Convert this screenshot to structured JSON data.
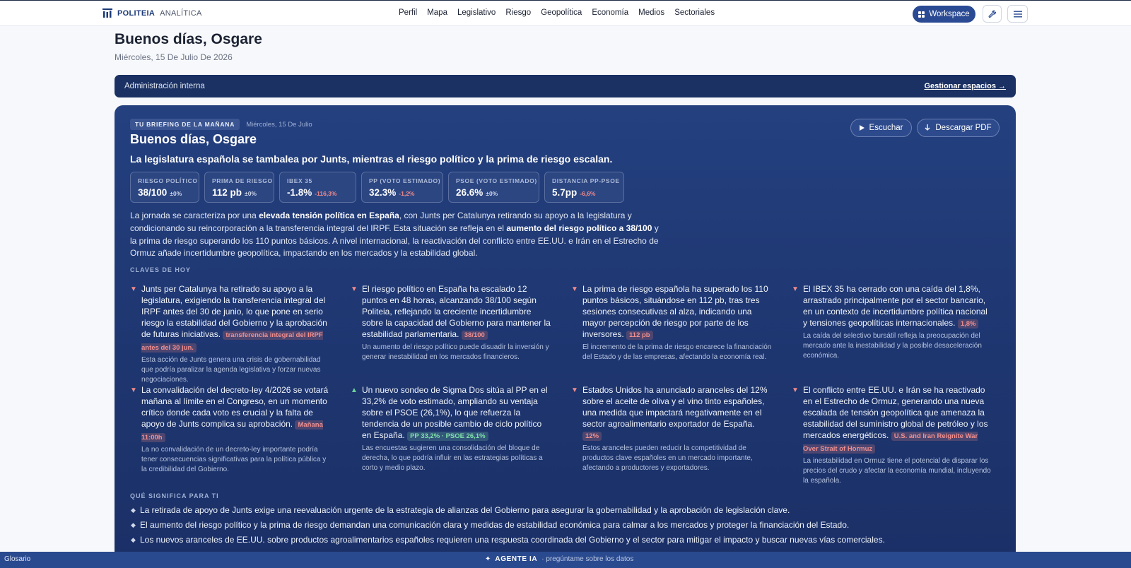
{
  "brand": {
    "strong": "POLITEIA",
    "light": "ANALÍTICA"
  },
  "nav": [
    "Perfil",
    "Mapa",
    "Legislativo",
    "Riesgo",
    "Geopolítica",
    "Economía",
    "Medios",
    "Sectoriales"
  ],
  "header": {
    "workspace_label": "Workspace",
    "tools_icon": "wrench-icon",
    "menu_icon": "hamburger-menu-icon"
  },
  "greeting": {
    "title": "Buenos días, Osgare",
    "date": "Miércoles, 15 De Julio De 2026"
  },
  "admin": {
    "label": "Administración interna",
    "link": "Gestionar espacios →"
  },
  "briefing": {
    "badge": "TU BRIEFING DE LA MAÑANA",
    "date": "Miércoles, 15 De Julio",
    "title": "Buenos días, Osgare",
    "headline": "La legislatura española se tambalea por Junts, mientras el riesgo político y la prima de riesgo escalan.",
    "listen_label": "Escuchar",
    "download_label": "Descargar PDF",
    "metrics": [
      {
        "label": "RIESGO POLÍTICO",
        "value": "38/100",
        "delta": "±0%",
        "tone": "neu"
      },
      {
        "label": "PRIMA DE RIESGO",
        "value": "112 pb",
        "delta": "±0%",
        "tone": "neu"
      },
      {
        "label": "IBEX 35",
        "value": "-1.8%",
        "delta": "-116,3%",
        "tone": "neg"
      },
      {
        "label": "PP (VOTO ESTIMADO)",
        "value": "32.3%",
        "delta": "-1,2%",
        "tone": "neg"
      },
      {
        "label": "PSOE (VOTO ESTIMADO)",
        "value": "26.6%",
        "delta": "±0%",
        "tone": "neu"
      },
      {
        "label": "DISTANCIA PP-PSOE",
        "value": "5.7pp",
        "delta": "-6,6%",
        "tone": "neg"
      }
    ],
    "summary": {
      "p1": "La jornada se caracteriza por una ",
      "b1": "elevada tensión política en España",
      "p2": ", con Junts per Catalunya retirando su apoyo a la legislatura y condicionando su reincorporación a la transferencia integral del IRPF. Esta situación se refleja en el ",
      "b2": "aumento del riesgo político a 38/100",
      "p3": " y la prima de riesgo superando los 110 puntos básicos. A nivel internacional, la reactivación del conflicto entre EE.UU. e Irán en el Estrecho de Ormuz añade incertidumbre geopolítica, impactando en los mercados y la estabilidad global."
    },
    "claves_label": "CLAVES DE HOY",
    "claims": [
      {
        "dir": "down",
        "text": "Junts per Catalunya ha retirado su apoyo a la legislatura, exigiendo la transferencia integral del IRPF antes del 30 de junio, lo que pone en serio riesgo la estabilidad del Gobierno y la aprobación de futuras iniciativas.",
        "tag": "transferencia integral del IRPF antes del 30 jun.",
        "tag_tone": "red",
        "sub": "Esta acción de Junts genera una crisis de gobernabilidad que podría paralizar la agenda legislativa y forzar nuevas negociaciones."
      },
      {
        "dir": "down",
        "text": "El riesgo político en España ha escalado 12 puntos en 48 horas, alcanzando 38/100 según Politeia, reflejando la creciente incertidumbre sobre la capacidad del Gobierno para mantener la estabilidad parlamentaria.",
        "tag": "38/100",
        "tag_tone": "red",
        "sub": "Un aumento del riesgo político puede disuadir la inversión y generar inestabilidad en los mercados financieros."
      },
      {
        "dir": "down",
        "text": "La prima de riesgo española ha superado los 110 puntos básicos, situándose en 112 pb, tras tres sesiones consecutivas al alza, indicando una mayor percepción de riesgo por parte de los inversores.",
        "tag": "112 pb",
        "tag_tone": "red",
        "sub": "El incremento de la prima de riesgo encarece la financiación del Estado y de las empresas, afectando la economía real."
      },
      {
        "dir": "down",
        "text": "El IBEX 35 ha cerrado con una caída del 1,8%, arrastrado principalmente por el sector bancario, en un contexto de incertidumbre política nacional y tensiones geopolíticas internacionales.",
        "tag": "1,8%",
        "tag_tone": "red",
        "sub": "La caída del selectivo bursátil refleja la preocupación del mercado ante la inestabilidad y la posible desaceleración económica."
      },
      {
        "dir": "down",
        "text": "La convalidación del decreto-ley 4/2026 se votará mañana al límite en el Congreso, en un momento crítico donde cada voto es crucial y la falta de apoyo de Junts complica su aprobación.",
        "tag": "Mañana 11:00h",
        "tag_tone": "red",
        "sub": "La no convalidación de un decreto-ley importante podría tener consecuencias significativas para la política pública y la credibilidad del Gobierno."
      },
      {
        "dir": "up",
        "text": "Un nuevo sondeo de Sigma Dos sitúa al PP en el 33,2% de voto estimado, ampliando su ventaja sobre el PSOE (26,1%), lo que refuerza la tendencia de un posible cambio de ciclo político en España.",
        "tag": "PP 33,2% · PSOE 26,1%",
        "tag_tone": "green",
        "sub": "Las encuestas sugieren una consolidación del bloque de derecha, lo que podría influir en las estrategias políticas a corto y medio plazo."
      },
      {
        "dir": "down",
        "text": "Estados Unidos ha anunciado aranceles del 12% sobre el aceite de oliva y el vino tinto españoles, una medida que impactará negativamente en el sector agroalimentario exportador de España.",
        "tag": "12%",
        "tag_tone": "red",
        "sub": "Estos aranceles pueden reducir la competitividad de productos clave españoles en un mercado importante, afectando a productores y exportadores."
      },
      {
        "dir": "down",
        "text": "El conflicto entre EE.UU. e Irán se ha reactivado en el Estrecho de Ormuz, generando una nueva escalada de tensión geopolítica que amenaza la estabilidad del suministro global de petróleo y los mercados energéticos.",
        "tag": "U.S. and Iran Reignite War Over Strait of Hormuz",
        "tag_tone": "red",
        "sub": "La inestabilidad en Ormuz tiene el potencial de disparar los precios del crudo y afectar la economía mundial, incluyendo la española."
      }
    ],
    "meaning_label": "QUÉ SIGNIFICA PARA TI",
    "bullets": [
      "La retirada de apoyo de Junts exige una reevaluación urgente de la estrategia de alianzas del Gobierno para asegurar la gobernabilidad y la aprobación de legislación clave.",
      "El aumento del riesgo político y la prima de riesgo demandan una comunicación clara y medidas de estabilidad económica para calmar a los mercados y proteger la financiación del Estado.",
      "Los nuevos aranceles de EE.UU. sobre productos agroalimentarios españoles requieren una respuesta coordinada del Gobierno y el sector para mitigar el impacto y buscar nuevas vías comerciales."
    ]
  },
  "footer": {
    "glossary": "Glosario",
    "agent_symbol": "✦",
    "agent_name": "AGENTE IA",
    "agent_hint": "· pregúntame sobre los datos"
  }
}
